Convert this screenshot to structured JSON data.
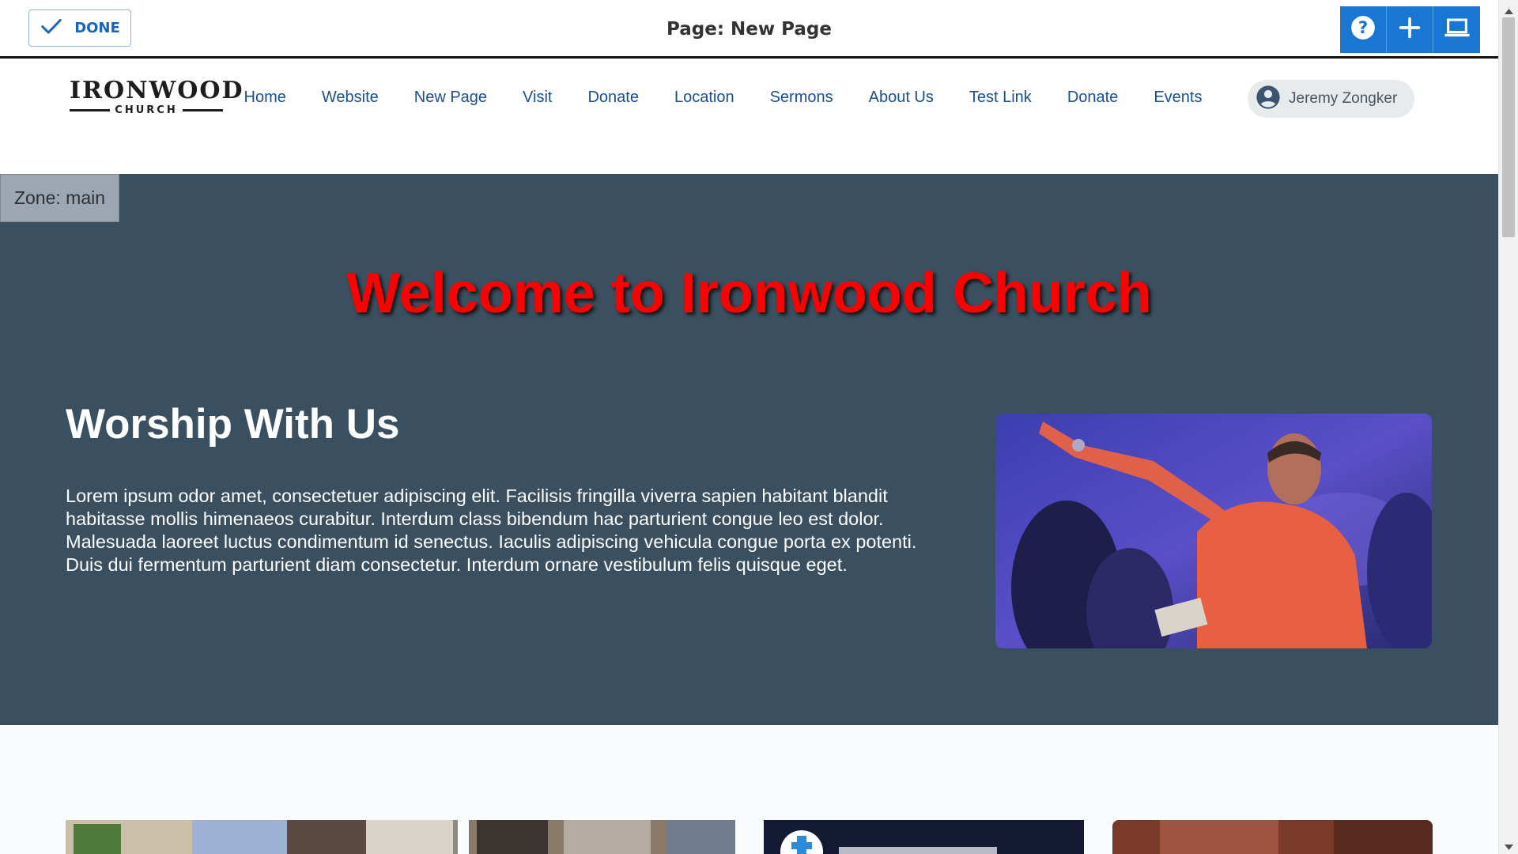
{
  "editor": {
    "done_label": "DONE",
    "page_title": "Page: New Page",
    "tools": [
      "help-icon",
      "add-icon",
      "laptop-icon"
    ],
    "accent_color": "#1976d2"
  },
  "header": {
    "logo": {
      "name": "IRONWOOD",
      "sub": "CHURCH"
    },
    "nav": [
      {
        "label": "Home"
      },
      {
        "label": "Website"
      },
      {
        "label": "New Page"
      },
      {
        "label": "Visit"
      },
      {
        "label": "Donate"
      },
      {
        "label": "Location"
      },
      {
        "label": "Sermons"
      },
      {
        "label": "About Us"
      },
      {
        "label": "Test Link"
      },
      {
        "label": "Donate"
      },
      {
        "label": "Events"
      }
    ],
    "user": {
      "name": "Jeremy Zongker",
      "icon": "account-circle-icon"
    }
  },
  "main": {
    "zone_label": "Zone: main",
    "welcome": "Welcome to Ironwood Church",
    "worship_title": "Worship With Us",
    "worship_body": "Lorem ipsum odor amet, consectetuer adipiscing elit. Facilisis fringilla viverra sapien habitant blandit habitasse mollis himenaeos curabitur. Interdum class bibendum hac parturient congue leo est dolor. Malesuada laoreet luctus condimentum id senectus. Iaculis adipiscing vehicula congue porta ex potenti. Duis dui fermentum parturient diam consectetur. Interdum ornare vestibulum felis quisque eget.",
    "background_color": "#3a5060",
    "welcome_color": "#ff0000"
  }
}
